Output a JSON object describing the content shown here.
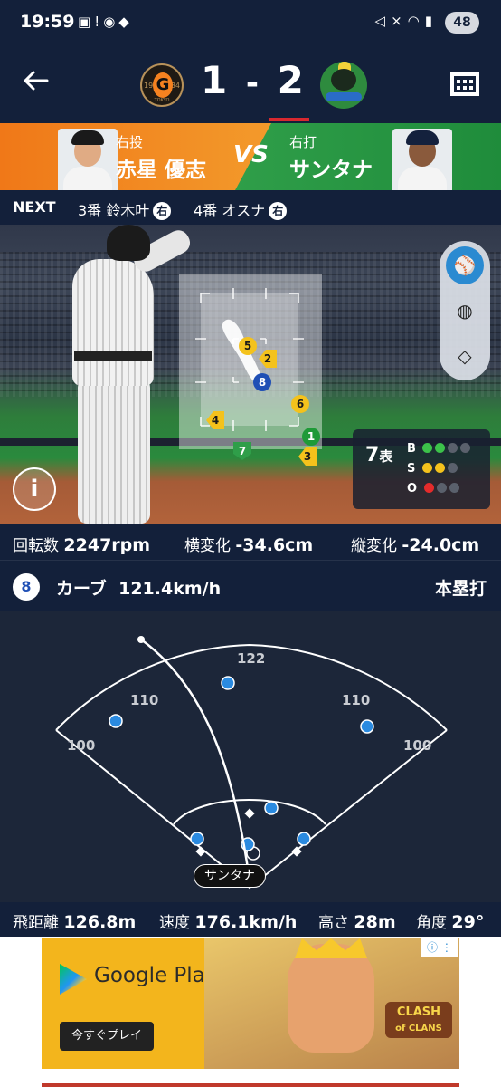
{
  "status_bar": {
    "time": "19:59",
    "battery": "48",
    "left_icons": [
      "bus-icon",
      "alert-icon",
      "giants-app-icon",
      "app-icon"
    ],
    "right_icons": [
      "mute-icon",
      "wifi-icon",
      "signal-icon"
    ]
  },
  "header": {
    "score_home": "1",
    "score_sep": "-",
    "score_away": "2",
    "home_logo_letter": "G",
    "home_logo_year_left": "19",
    "home_logo_year_right": "34",
    "home_logo_subtext": "TOKYO",
    "colors": {
      "bg": "#13203a",
      "tab_indicator": "#d9282f"
    }
  },
  "matchup": {
    "pitcher_role": "右投",
    "pitcher_name": "赤星 優志",
    "vs": "VS",
    "batter_role": "右打",
    "batter_name": "サンタナ",
    "colors": {
      "pitcher_side": "#f07818",
      "batter_side": "#2f9e49"
    }
  },
  "next": {
    "label": "NEXT",
    "batters": [
      {
        "order": "3番 鈴木叶",
        "hand": "右"
      },
      {
        "order": "4番 オスナ",
        "hand": "右"
      }
    ]
  },
  "field": {
    "pitch_marks": [
      {
        "n": "1",
        "shape": "green"
      },
      {
        "n": "2",
        "shape": "diamond"
      },
      {
        "n": "3",
        "shape": "diamond"
      },
      {
        "n": "4",
        "shape": "diamond"
      },
      {
        "n": "5",
        "shape": "ball"
      },
      {
        "n": "6",
        "shape": "ball"
      },
      {
        "n": "7",
        "shape": "shield"
      },
      {
        "n": "8",
        "shape": "dark"
      }
    ],
    "tools": [
      "batter-view-icon",
      "ball-icon",
      "diamond-field-icon"
    ],
    "count": {
      "inning": "7",
      "half": "表",
      "b_label": "B",
      "s_label": "S",
      "o_label": "O",
      "balls": 2,
      "strikes": 2,
      "outs": 1
    }
  },
  "pitch_metrics": {
    "spin_label": "回転数",
    "spin_value": "2247rpm",
    "h_break_label": "横変化",
    "h_break_value": "-34.6cm",
    "v_break_label": "縦変化",
    "v_break_value": "-24.0cm"
  },
  "pitch_info": {
    "number": "8",
    "type": "カーブ",
    "speed": "121.4km/h",
    "result": "本塁打"
  },
  "spray_chart": {
    "distance_labels": [
      "122",
      "110",
      "110",
      "100",
      "100"
    ],
    "batter_tag": "サンタナ"
  },
  "hit_stats": {
    "distance_label": "飛距離",
    "distance_value": "126.8m",
    "speed_label": "速度",
    "speed_value": "176.1km/h",
    "height_label": "高さ",
    "height_value": "28m",
    "angle_label": "角度",
    "angle_value": "29°"
  },
  "ad": {
    "store": "Google Play",
    "cta": "今すぐプレイ",
    "game_logo_line1": "CLASH",
    "game_logo_line2": "of CLANS"
  }
}
